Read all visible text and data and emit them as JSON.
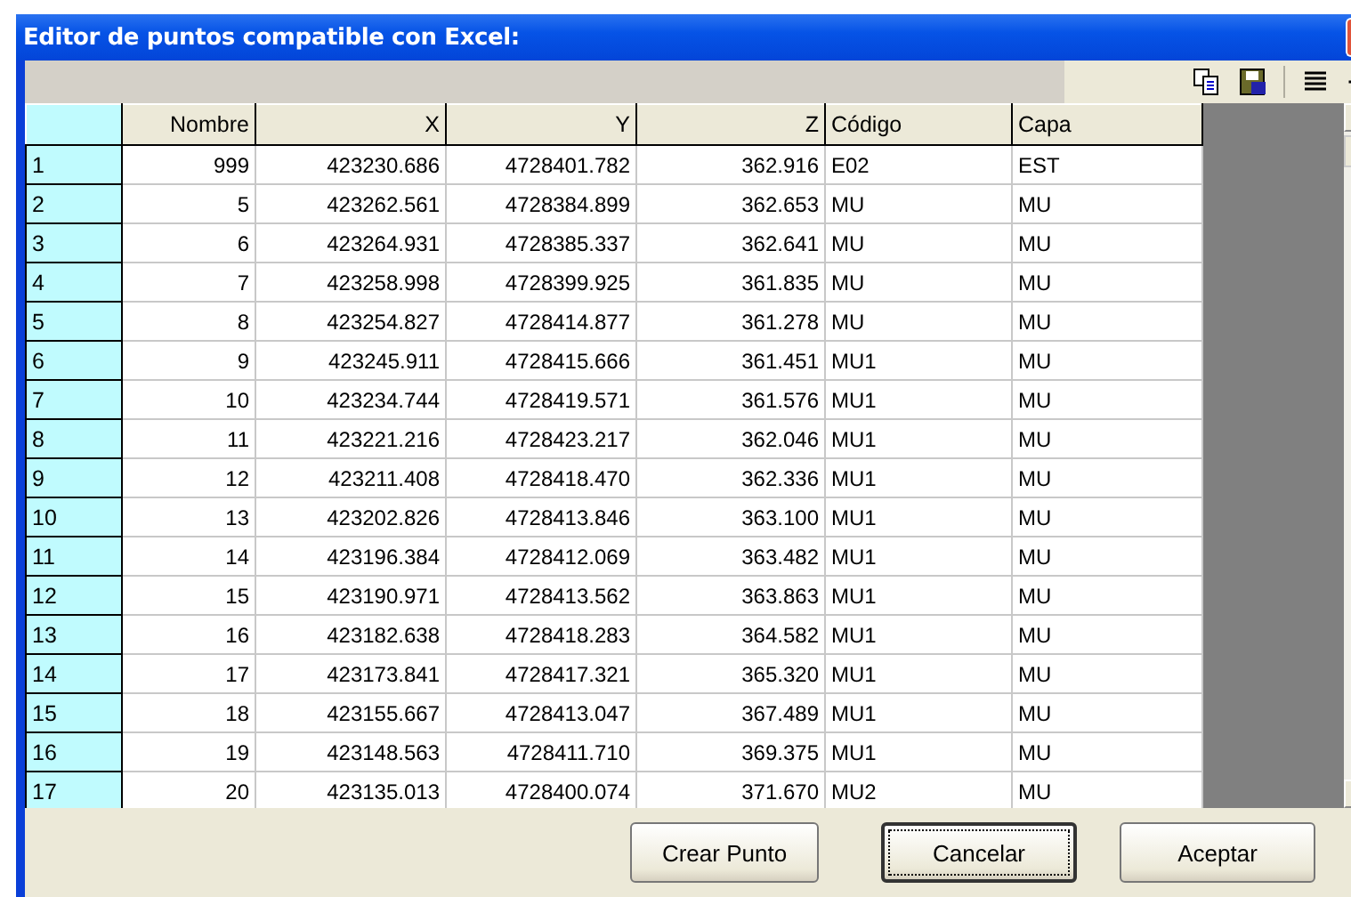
{
  "window": {
    "title": "Editor de puntos compatible con Excel:"
  },
  "table": {
    "columns": [
      "Nombre",
      "X",
      "Y",
      "Z",
      "Código",
      "Capa"
    ],
    "rows": [
      {
        "index": "1",
        "cells": [
          "999",
          "423230.686",
          "4728401.782",
          "362.916",
          "E02",
          "EST"
        ]
      },
      {
        "index": "2",
        "cells": [
          "5",
          "423262.561",
          "4728384.899",
          "362.653",
          "MU",
          "MU"
        ]
      },
      {
        "index": "3",
        "cells": [
          "6",
          "423264.931",
          "4728385.337",
          "362.641",
          "MU",
          "MU"
        ]
      },
      {
        "index": "4",
        "cells": [
          "7",
          "423258.998",
          "4728399.925",
          "361.835",
          "MU",
          "MU"
        ]
      },
      {
        "index": "5",
        "cells": [
          "8",
          "423254.827",
          "4728414.877",
          "361.278",
          "MU",
          "MU"
        ]
      },
      {
        "index": "6",
        "cells": [
          "9",
          "423245.911",
          "4728415.666",
          "361.451",
          "MU1",
          "MU"
        ]
      },
      {
        "index": "7",
        "cells": [
          "10",
          "423234.744",
          "4728419.571",
          "361.576",
          "MU1",
          "MU"
        ]
      },
      {
        "index": "8",
        "cells": [
          "11",
          "423221.216",
          "4728423.217",
          "362.046",
          "MU1",
          "MU"
        ]
      },
      {
        "index": "9",
        "cells": [
          "12",
          "423211.408",
          "4728418.470",
          "362.336",
          "MU1",
          "MU"
        ]
      },
      {
        "index": "10",
        "cells": [
          "13",
          "423202.826",
          "4728413.846",
          "363.100",
          "MU1",
          "MU"
        ]
      },
      {
        "index": "11",
        "cells": [
          "14",
          "423196.384",
          "4728412.069",
          "363.482",
          "MU1",
          "MU"
        ]
      },
      {
        "index": "12",
        "cells": [
          "15",
          "423190.971",
          "4728413.562",
          "363.863",
          "MU1",
          "MU"
        ]
      },
      {
        "index": "13",
        "cells": [
          "16",
          "423182.638",
          "4728418.283",
          "364.582",
          "MU1",
          "MU"
        ]
      },
      {
        "index": "14",
        "cells": [
          "17",
          "423173.841",
          "4728417.321",
          "365.320",
          "MU1",
          "MU"
        ]
      },
      {
        "index": "15",
        "cells": [
          "18",
          "423155.667",
          "4728413.047",
          "367.489",
          "MU1",
          "MU"
        ]
      },
      {
        "index": "16",
        "cells": [
          "19",
          "423148.563",
          "4728411.710",
          "369.375",
          "MU1",
          "MU"
        ]
      },
      {
        "index": "17",
        "cells": [
          "20",
          "423135.013",
          "4728400.074",
          "371.670",
          "MU2",
          "MU"
        ]
      }
    ]
  },
  "buttons": [
    {
      "label": "Crear Punto",
      "focused": false
    },
    {
      "label": "Cancelar",
      "focused": true
    },
    {
      "label": "Aceptar",
      "focused": false
    }
  ]
}
